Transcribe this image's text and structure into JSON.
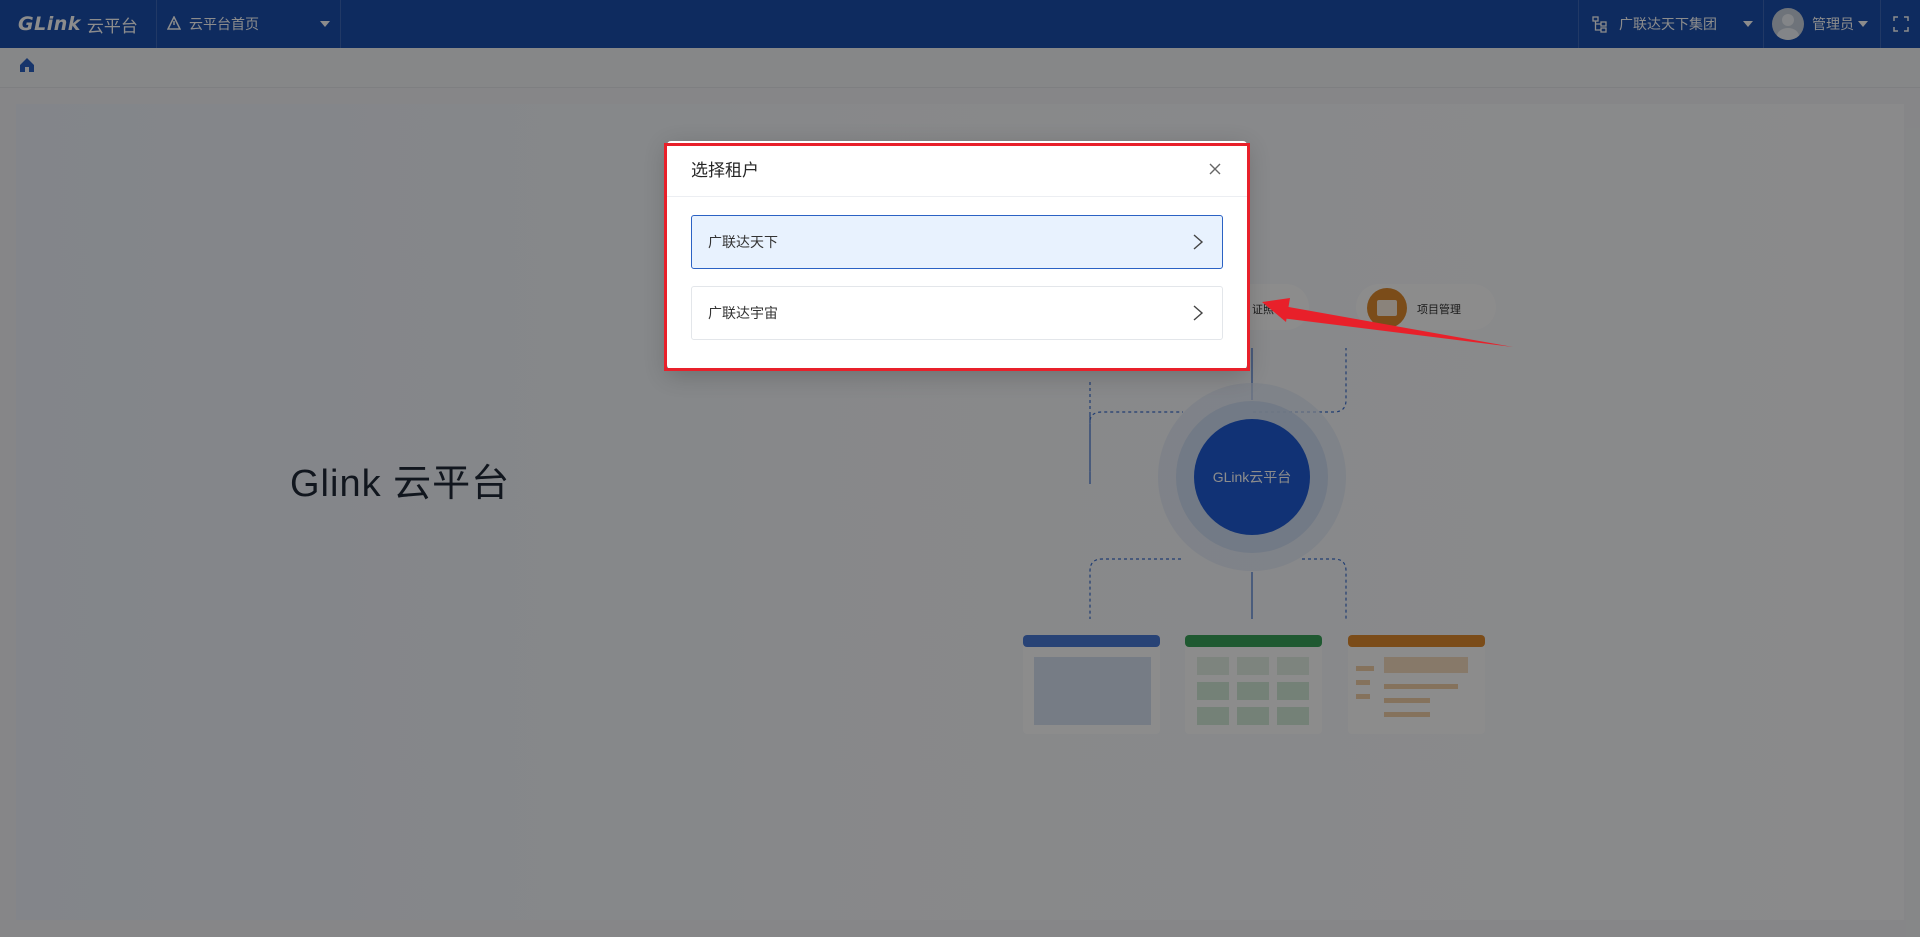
{
  "header": {
    "logo_mark": "GLink",
    "logo_text": "云平台",
    "home_selector": "云平台首页",
    "org_selector": "广联达天下集团",
    "user_name": "管理员"
  },
  "main": {
    "hero_title": "Glink 云平台",
    "diagram": {
      "center_label": "GLink云平台",
      "node_cert_partial": "证照",
      "node_project": "项目管理"
    }
  },
  "modal": {
    "title": "选择租户",
    "tenants": [
      {
        "label": "广联达天下",
        "active": true
      },
      {
        "label": "广联达宇宙",
        "active": false
      }
    ]
  },
  "colors": {
    "header_bg": "#1b4fae",
    "accent": "#2b62c4",
    "active_item_bg": "#e8f2fe",
    "annotation_red": "#e8202a"
  },
  "icons": {
    "home_selector": "warning-triangle-icon",
    "org": "org-tree-icon",
    "fullscreen": "fullscreen-icon",
    "breadcrumb": "home-icon",
    "modal_close": "close-icon",
    "tenant_item": "chevron-right-icon"
  }
}
